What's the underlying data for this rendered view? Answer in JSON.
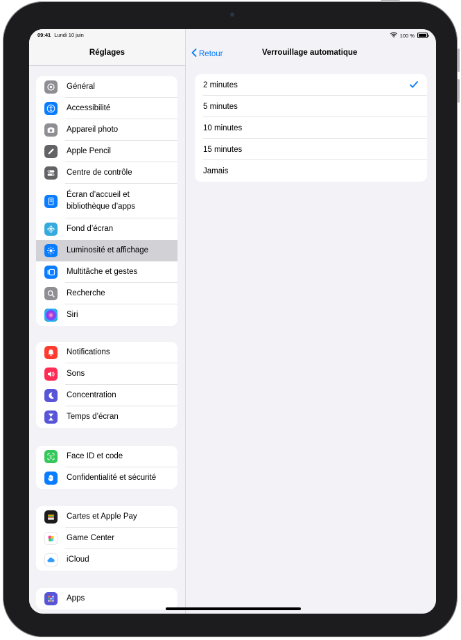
{
  "status_bar": {
    "time": "09:41",
    "date": "Lundi 10 juin",
    "battery": "100 %"
  },
  "sidebar": {
    "title": "Réglages",
    "groups": [
      {
        "items": [
          {
            "label": "Général",
            "icon": "gear-icon",
            "color": "#8e8e93"
          },
          {
            "label": "Accessibilité",
            "icon": "accessibility-icon",
            "color": "#0a7cff"
          },
          {
            "label": "Appareil photo",
            "icon": "camera-icon",
            "color": "#8e8e93"
          },
          {
            "label": "Apple Pencil",
            "icon": "pencil-icon",
            "color": "#636366"
          },
          {
            "label": "Centre de contrôle",
            "icon": "toggles-icon",
            "color": "#636366"
          },
          {
            "label": "Écran d’accueil et bibliothèque d’apps",
            "icon": "home-screen-icon",
            "color": "#0a7cff"
          },
          {
            "label": "Fond d’écran",
            "icon": "flower-icon",
            "color": "#35aadc"
          },
          {
            "label": "Luminosité et affichage",
            "icon": "brightness-icon",
            "color": "#0a7cff",
            "selected": true
          },
          {
            "label": "Multitâche et gestes",
            "icon": "multitasking-icon",
            "color": "#0a7cff"
          },
          {
            "label": "Recherche",
            "icon": "search-icon",
            "color": "#8e8e93"
          },
          {
            "label": "Siri",
            "icon": "siri-icon",
            "color": "#1c1c1e"
          }
        ]
      },
      {
        "items": [
          {
            "label": "Notifications",
            "icon": "bell-icon",
            "color": "#ff3b30"
          },
          {
            "label": "Sons",
            "icon": "speaker-icon",
            "color": "#ff2d55"
          },
          {
            "label": "Concentration",
            "icon": "moon-icon",
            "color": "#5856d6"
          },
          {
            "label": "Temps d’écran",
            "icon": "hourglass-icon",
            "color": "#5856d6"
          }
        ]
      },
      {
        "items": [
          {
            "label": "Face ID et code",
            "icon": "face-id-icon",
            "color": "#34c759"
          },
          {
            "label": "Confidentialité et sécurité",
            "icon": "hand-icon",
            "color": "#0a7cff"
          }
        ]
      },
      {
        "items": [
          {
            "label": "Cartes et Apple Pay",
            "icon": "wallet-icon",
            "color": "#1c1c1e"
          },
          {
            "label": "Game Center",
            "icon": "game-center-icon",
            "color": "#ffffff"
          },
          {
            "label": "iCloud",
            "icon": "cloud-icon",
            "color": "#ffffff"
          }
        ]
      },
      {
        "items": [
          {
            "label": "Apps",
            "icon": "apps-grid-icon",
            "color": "#5856d6"
          }
        ]
      }
    ]
  },
  "detail": {
    "back_label": "Retour",
    "title": "Verrouillage automatique",
    "options": [
      {
        "label": "2 minutes",
        "checked": true
      },
      {
        "label": "5 minutes"
      },
      {
        "label": "10 minutes"
      },
      {
        "label": "15 minutes"
      },
      {
        "label": "Jamais"
      }
    ],
    "accent_color": "#007aff"
  }
}
